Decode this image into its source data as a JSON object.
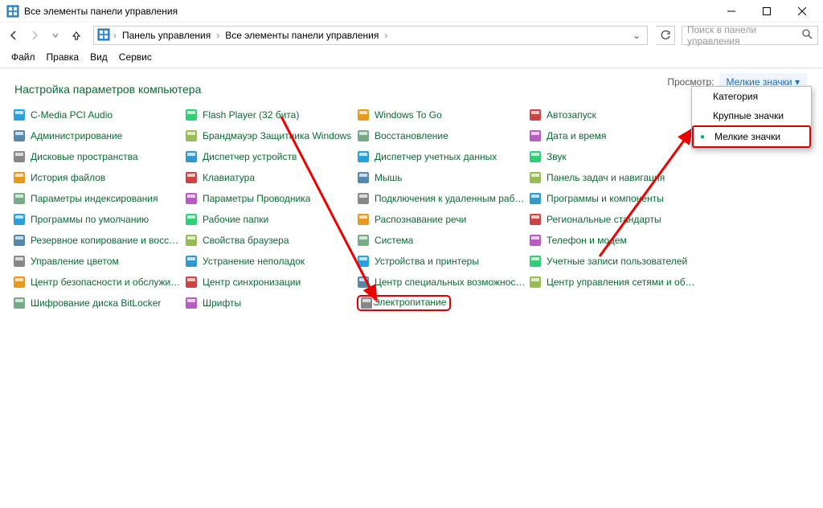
{
  "window": {
    "title": "Все элементы панели управления"
  },
  "breadcrumb": {
    "root": "Панель управления",
    "current": "Все элементы панели управления"
  },
  "search": {
    "placeholder": "Поиск в панели управления"
  },
  "menu": {
    "file": "Файл",
    "edit": "Правка",
    "view": "Вид",
    "service": "Сервис"
  },
  "heading": "Настройка параметров компьютера",
  "viewLabel": "Просмотр:",
  "viewSelected": "Мелкие значки ▾",
  "dropdown": {
    "category": "Категория",
    "large": "Крупные значки",
    "small": "Мелкие значки"
  },
  "items": {
    "c0": [
      "C-Media PCI Audio",
      "Администрирование",
      "Дисковые пространства",
      "История файлов",
      "Параметры индексирования",
      "Программы по умолчанию",
      "Резервное копирование и восстан...",
      "Управление цветом",
      "Центр безопасности и обслуживан...",
      "Шифрование диска BitLocker"
    ],
    "c1": [
      "Flash Player (32 бита)",
      "Брандмауэр Защитника Windows",
      "Диспетчер устройств",
      "Клавиатура",
      "Параметры Проводника",
      "Рабочие папки",
      "Свойства браузера",
      "Устранение неполадок",
      "Центр синхронизации",
      "Шрифты"
    ],
    "c2": [
      "Windows To Go",
      "Восстановление",
      "Диспетчер учетных данных",
      "Мышь",
      "Подключения к удаленным рабоч...",
      "Распознавание речи",
      "Система",
      "Устройства и принтеры",
      "Центр специальных возможностей",
      "Электропитание"
    ],
    "c3": [
      "Автозапуск",
      "Дата и время",
      "Звук",
      "Панель задач и навигация",
      "Программы и компоненты",
      "Региональные стандарты",
      "Телефон и модем",
      "Учетные записи пользователей",
      "Центр управления сетями и общи..."
    ]
  }
}
